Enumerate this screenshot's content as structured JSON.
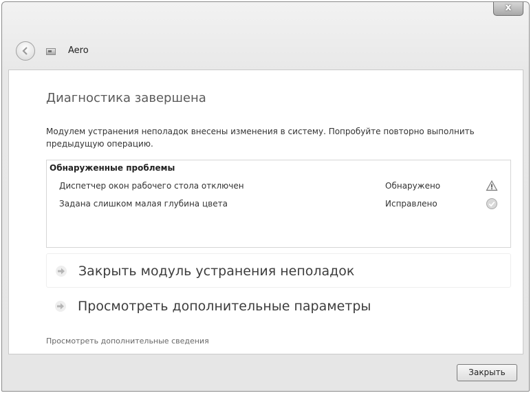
{
  "window": {
    "title": "Aero",
    "close_symbol": "x"
  },
  "main": {
    "heading": "Диагностика завершена",
    "description": "Модулем устранения неполадок внесены изменения в систему. Попробуйте повторно выполнить предыдущую операцию.",
    "problems_title": "Обнаруженные проблемы",
    "problems": [
      {
        "name": "Диспетчер окон рабочего стола отключен",
        "status": "Обнаружено",
        "icon": "warning-icon"
      },
      {
        "name": "Задана слишком малая глубина цвета",
        "status": "Исправлено",
        "icon": "check-icon"
      }
    ],
    "actions": [
      {
        "label": "Закрыть модуль устранения неполадок",
        "icon": "arrow-right-icon"
      },
      {
        "label": "Просмотреть дополнительные параметры",
        "icon": "arrow-right-icon"
      }
    ],
    "more_info": "Просмотреть дополнительные сведения"
  },
  "footer": {
    "close_label": "Закрыть"
  },
  "colors": {
    "window_frame": "#e8e8e8",
    "content_bg": "#ffffff",
    "link_text": "#3d3d3d"
  }
}
